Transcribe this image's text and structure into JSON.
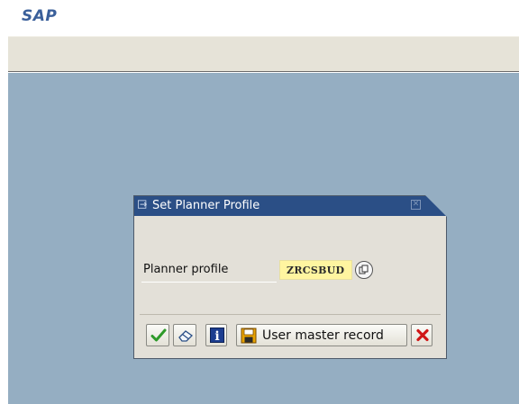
{
  "app": {
    "logo_text": "SAP"
  },
  "dialog": {
    "title": "Set Planner Profile",
    "field": {
      "label": "Planner profile",
      "value": "ZRCSBUD"
    },
    "buttons": {
      "continue_icon": "checkmark-icon",
      "eraser_icon": "eraser-icon",
      "info_icon": "info-icon",
      "save_icon": "save-icon",
      "user_master_record_label": "User master record",
      "cancel_icon": "cancel-x-icon"
    },
    "colors": {
      "title_bar": "#2b4f86",
      "desktop": "#95aec2",
      "input_background": "#fff5a0",
      "dialog_background": "#e3e0d8",
      "checkmark": "#2e9a2a",
      "cancel": "#d01616"
    }
  }
}
